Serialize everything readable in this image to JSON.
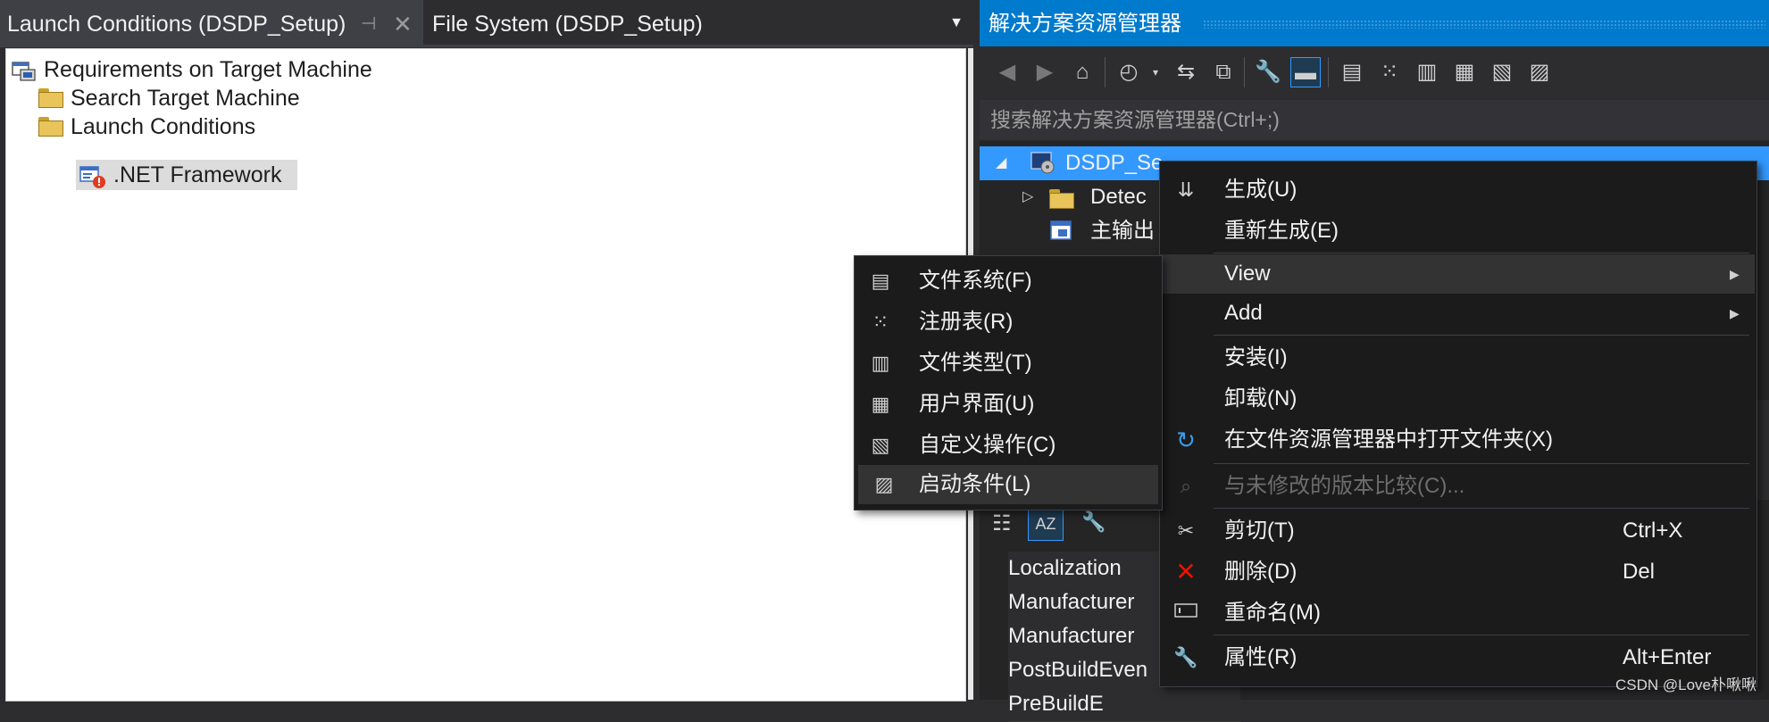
{
  "tabs": {
    "active_label": "Launch Conditions (DSDP_Setup)",
    "pin_glyph": "⊣",
    "close_glyph": "✕",
    "inactive_label": "File System (DSDP_Setup)",
    "dropdown_glyph": "▼"
  },
  "tree": {
    "root": "Requirements on Target Machine",
    "child1": "Search Target Machine",
    "child2": "Launch Conditions",
    "grandchild": ".NET Framework"
  },
  "solution_explorer": {
    "title": "解决方案资源管理器",
    "search_placeholder": "搜索解决方案资源管理器(Ctrl+;)",
    "rows": [
      "DSDP_Se",
      "Detec",
      "主输出"
    ]
  },
  "properties": {
    "rows": [
      "Localization",
      "Manufacturer",
      "Manufacturer",
      "PostBuildEven",
      "PreBuildE"
    ]
  },
  "context_menu": {
    "build": "生成(U)",
    "rebuild": "重新生成(E)",
    "view": "View",
    "add": "Add",
    "install": "安装(I)",
    "uninstall": "卸载(N)",
    "open_folder": "在文件资源管理器中打开文件夹(X)",
    "compare": "与未修改的版本比较(C)...",
    "cut": "剪切(T)",
    "cut_shortcut": "Ctrl+X",
    "delete": "删除(D)",
    "delete_shortcut": "Del",
    "rename": "重命名(M)",
    "properties": "属性(R)",
    "properties_shortcut": "Alt+Enter"
  },
  "view_submenu": {
    "file_system": "文件系统(F)",
    "registry": "注册表(R)",
    "file_types": "文件类型(T)",
    "user_interface": "用户界面(U)",
    "custom_actions": "自定义操作(C)",
    "launch_conditions": "启动条件(L)"
  },
  "watermark": "CSDN @Love朴啾啾",
  "colors": {
    "accent": "#007acc",
    "selection": "#3399ff",
    "menu_bg": "#1b1b1c",
    "delete_icon": "#e51400"
  }
}
